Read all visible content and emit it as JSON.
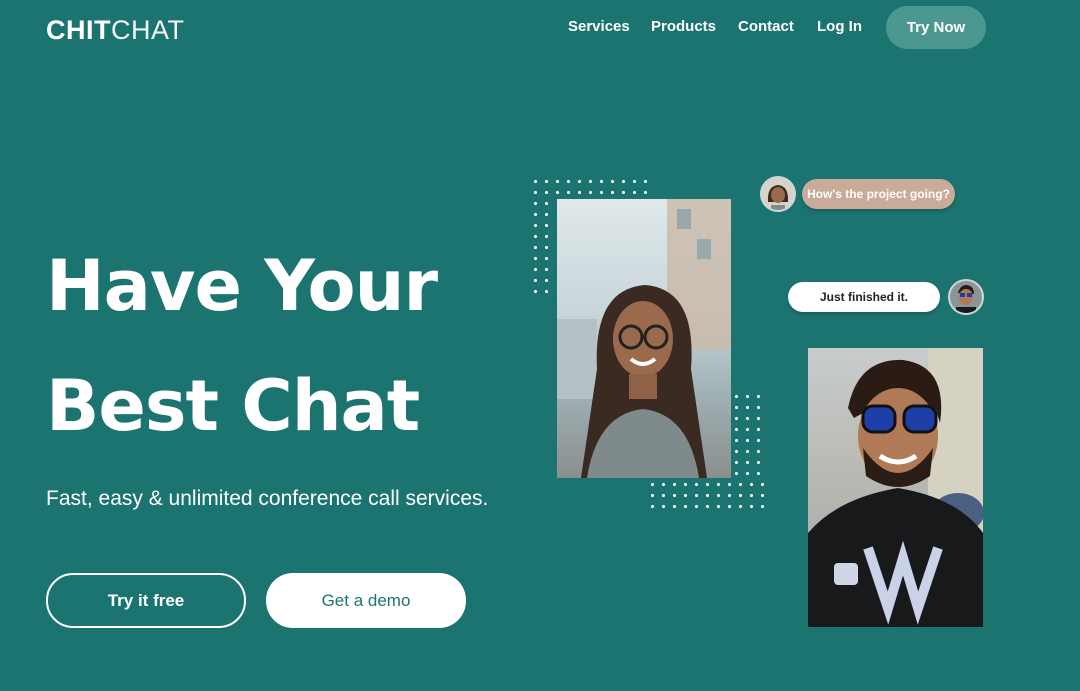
{
  "brand": {
    "bold": "CHIT",
    "thin": "CHAT"
  },
  "nav": {
    "items": [
      {
        "label": "Services"
      },
      {
        "label": "Products"
      },
      {
        "label": "Contact"
      },
      {
        "label": "Log In"
      }
    ],
    "cta": "Try Now"
  },
  "hero": {
    "headline_line1": "Have Your",
    "headline_line2": "Best Chat",
    "subtitle": "Fast, easy & unlimited conference call services.",
    "primary_button": "Try it free",
    "secondary_button": "Get a demo"
  },
  "chat": {
    "message_1": "How's the project going?",
    "message_2": "Just finished it."
  },
  "colors": {
    "background": "#1b7470",
    "nav_cta": "#4d9792",
    "bubble_incoming": "#c9ab99",
    "bubble_outgoing": "#ffffff"
  }
}
